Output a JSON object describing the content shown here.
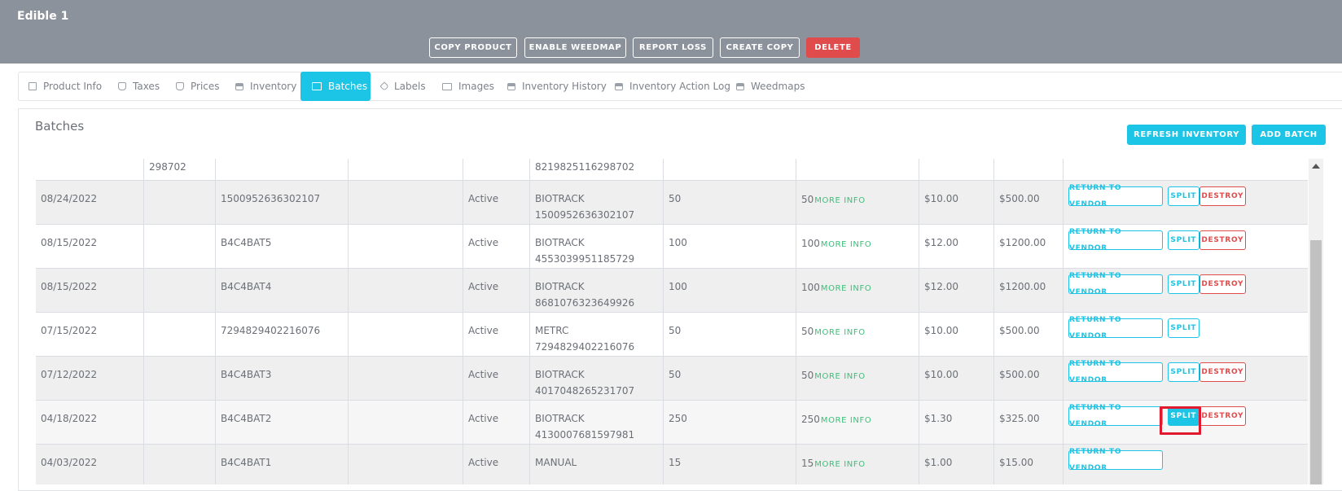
{
  "header": {
    "title": "Edible 1",
    "buttons": {
      "copy_product": "COPY PRODUCT",
      "enable_weedmap": "ENABLE WEEDMAP",
      "report_loss": "REPORT LOSS",
      "create_copy": "CREATE COPY",
      "delete": "DELETE"
    }
  },
  "tabs": [
    {
      "label": "Product Info",
      "icon": "store-icon"
    },
    {
      "label": "Taxes",
      "icon": "money-bag-icon"
    },
    {
      "label": "Prices",
      "icon": "money-bag-icon"
    },
    {
      "label": "Inventory",
      "icon": "lock-icon"
    },
    {
      "label": "Batches",
      "icon": "box-icon",
      "active": true
    },
    {
      "label": "Labels",
      "icon": "tag-icon"
    },
    {
      "label": "Images",
      "icon": "image-icon"
    },
    {
      "label": "Inventory History",
      "icon": "lock-icon"
    },
    {
      "label": "Inventory Action Log",
      "icon": "lock-icon"
    },
    {
      "label": "Weedmaps",
      "icon": "lock-icon"
    }
  ],
  "panel": {
    "title": "Batches",
    "refresh_label": "REFRESH INVENTORY",
    "add_batch_label": "ADD BATCH"
  },
  "actions": {
    "return_to_vendor": "RETURN TO VENDOR",
    "split": "SPLIT",
    "destroy": "DESTROY",
    "more_info": "MORE INFO"
  },
  "batches": [
    {
      "date": "",
      "col2": "298702",
      "batch": "",
      "status": "",
      "source": "",
      "source_id": "8219825116298702",
      "qty": "",
      "qty_more": "",
      "cost": "",
      "total": "",
      "partial": true
    },
    {
      "date": "08/24/2022",
      "col2": "",
      "batch": "1500952636302107",
      "status": "Active",
      "source": "BIOTRACK",
      "source_id": "1500952636302107",
      "qty": "50",
      "qty_more": "50",
      "cost": "$10.00",
      "total": "$500.00",
      "destroy": true
    },
    {
      "date": "08/15/2022",
      "col2": "",
      "batch": "B4C4BAT5",
      "status": "Active",
      "source": "BIOTRACK",
      "source_id": "4553039951185729",
      "qty": "100",
      "qty_more": "100",
      "cost": "$12.00",
      "total": "$1200.00",
      "destroy": true
    },
    {
      "date": "08/15/2022",
      "col2": "",
      "batch": "B4C4BAT4",
      "status": "Active",
      "source": "BIOTRACK",
      "source_id": "8681076323649926",
      "qty": "100",
      "qty_more": "100",
      "cost": "$12.00",
      "total": "$1200.00",
      "destroy": true
    },
    {
      "date": "07/15/2022",
      "col2": "",
      "batch": "7294829402216076",
      "status": "Active",
      "source": "METRC",
      "source_id": "7294829402216076",
      "qty": "50",
      "qty_more": "50",
      "cost": "$10.00",
      "total": "$500.00",
      "destroy": false
    },
    {
      "date": "07/12/2022",
      "col2": "",
      "batch": "B4C4BAT3",
      "status": "Active",
      "source": "BIOTRACK",
      "source_id": "4017048265231707",
      "qty": "50",
      "qty_more": "50",
      "cost": "$10.00",
      "total": "$500.00",
      "destroy": true
    },
    {
      "date": "04/18/2022",
      "col2": "",
      "batch": "B4C4BAT2",
      "status": "Active",
      "source": "BIOTRACK",
      "source_id": "4130007681597981",
      "qty": "250",
      "qty_more": "250",
      "cost": "$1.30",
      "total": "$325.00",
      "destroy": true,
      "split_highlighted": true
    },
    {
      "date": "04/03/2022",
      "col2": "",
      "batch": "B4C4BAT1",
      "status": "Active",
      "source": "MANUAL",
      "source_id": "",
      "qty": "15",
      "qty_more": "15",
      "cost": "$1.00",
      "total": "$15.00",
      "destroy": false,
      "split": false
    }
  ]
}
